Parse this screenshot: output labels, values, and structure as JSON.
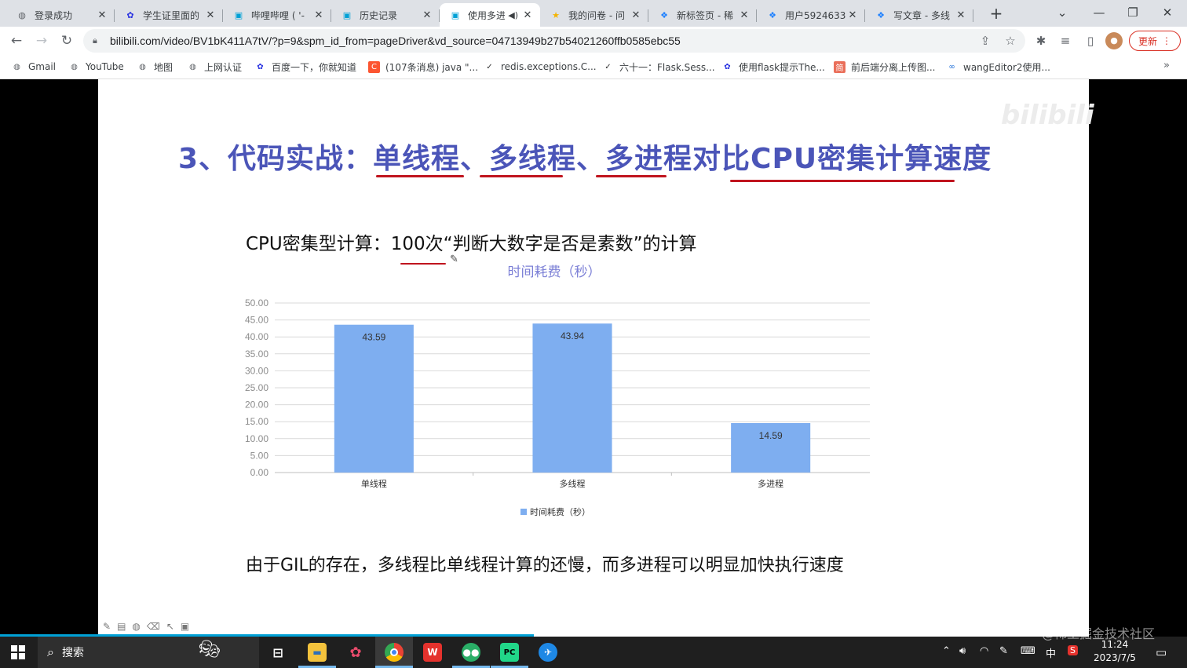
{
  "browser": {
    "tabs": [
      {
        "title": "登录成功",
        "icon": "globe-icon",
        "icon_color": "#5f6368"
      },
      {
        "title": "学生证里面的",
        "icon": "baidu-paw-icon",
        "icon_color": "#2932e1"
      },
      {
        "title": "哔哩哔哩 ( '-",
        "icon": "bilibili-tv-icon",
        "icon_color": "#00a1d6"
      },
      {
        "title": "历史记录",
        "icon": "bilibili-tv-icon",
        "icon_color": "#00a1d6"
      },
      {
        "title": "使用多进",
        "icon": "bilibili-tv-icon",
        "icon_color": "#00a1d6",
        "active": true,
        "audio": true
      },
      {
        "title": "我的问卷 - 问",
        "icon": "star-icon",
        "icon_color": "#f4b400"
      },
      {
        "title": "新标签页 - 稀",
        "icon": "juejin-icon",
        "icon_color": "#1e80ff"
      },
      {
        "title": "用户5924633",
        "icon": "juejin-icon",
        "icon_color": "#1e80ff"
      },
      {
        "title": "写文章 - 多线",
        "icon": "juejin-icon",
        "icon_color": "#1e80ff"
      }
    ],
    "url": "bilibili.com/video/BV1bK411A7tV/?p=9&spm_id_from=pageDriver&vd_source=04713949b27b54021260ffb0585ebc55",
    "update_label": "更新",
    "bookmarks": [
      {
        "label": "Gmail",
        "icon": "globe-icon"
      },
      {
        "label": "YouTube",
        "icon": "globe-icon"
      },
      {
        "label": "地图",
        "icon": "globe-icon"
      },
      {
        "label": "上网认证",
        "icon": "globe-icon"
      },
      {
        "label": "百度一下，你就知道",
        "icon": "baidu-paw-icon"
      },
      {
        "label": "(107条消息) java \"...",
        "icon": "csdn-icon"
      },
      {
        "label": "redis.exceptions.C...",
        "icon": "bird-icon"
      },
      {
        "label": "六十一：Flask.Sess...",
        "icon": "bird-icon"
      },
      {
        "label": "使用flask提示The...",
        "icon": "baidu-paw-icon"
      },
      {
        "label": "前后端分离上传图...",
        "icon": "jianshu-icon"
      },
      {
        "label": "wangEditor2使用...",
        "icon": "infinity-icon"
      }
    ]
  },
  "slide": {
    "watermark": "bilibili",
    "title": "3、代码实战：单线程、多线程、多进程对比CPU密集计算速度",
    "subtitle": "CPU密集型计算：100次“判断大数字是否是素数”的计算",
    "conclusion": "由于GIL的存在，多线程比单线程计算的还慢，而多进程可以明显加快执行速度",
    "accent_color": "#4b55b8",
    "underline_color": "#c0141e"
  },
  "chart_data": {
    "type": "bar",
    "title": "时间耗费（秒）",
    "categories": [
      "单线程",
      "多线程",
      "多进程"
    ],
    "series": [
      {
        "name": "时间耗费（秒）",
        "values": [
          43.59,
          43.94,
          14.59
        ]
      }
    ],
    "data_labels": [
      "43.59",
      "43.94",
      "14.59"
    ],
    "ylim": [
      0,
      50
    ],
    "yticks": [
      "0.00",
      "5.00",
      "10.00",
      "15.00",
      "20.00",
      "25.00",
      "30.00",
      "35.00",
      "40.00",
      "45.00",
      "50.00"
    ],
    "grid": true,
    "legend": "bottom",
    "bar_color": "#7eaef0",
    "title_color": "#7b7fd6"
  },
  "taskbar": {
    "search_label": "搜索",
    "apps": [
      "task-view-icon",
      "file-explorer-icon",
      "paint-icon",
      "chrome-icon",
      "wps-icon",
      "wechat-icon",
      "pycharm-icon",
      "feishu-icon"
    ],
    "tray": {
      "ime": "中",
      "time": "11:24",
      "date": "2023/7/5"
    }
  },
  "overlay_watermark": "@稀土掘金技术社区"
}
